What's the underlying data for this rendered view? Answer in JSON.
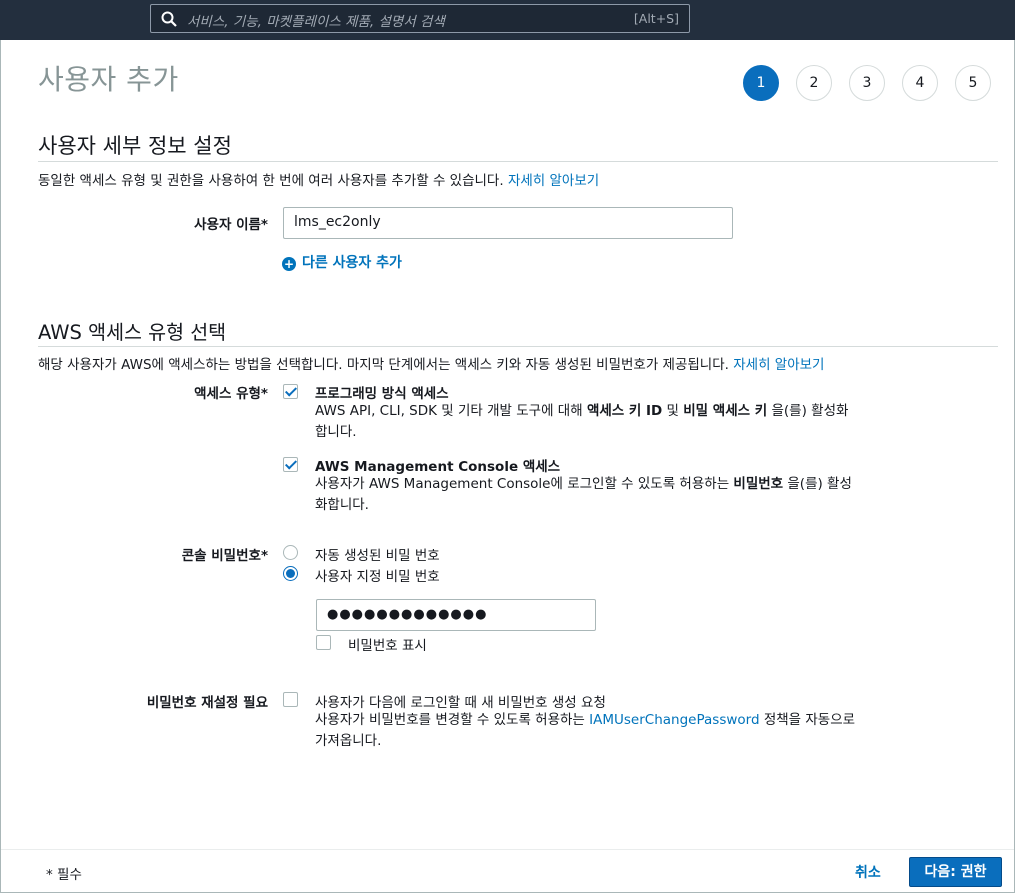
{
  "search": {
    "placeholder": "서비스, 기능, 마켓플레이스 제품, 설명서 검색",
    "shortcut": "[Alt+S]"
  },
  "page": {
    "title": "사용자 추가"
  },
  "steps": [
    "1",
    "2",
    "3",
    "4",
    "5"
  ],
  "active_step": 1,
  "details": {
    "title": "사용자 세부 정보 설정",
    "desc": "동일한 액세스 유형 및 권한을 사용하여 한 번에 여러 사용자를 추가할 수 있습니다. ",
    "learn_more": "자세히 알아보기",
    "username_label": "사용자 이름*",
    "username_value": "lms_ec2only",
    "add_user": "다른 사용자 추가"
  },
  "access": {
    "title": "AWS 액세스 유형 선택",
    "desc": "해당 사용자가 AWS에 액세스하는 방법을 선택합니다. 마지막 단계에서는 액세스 키와 자동 생성된 비밀번호가 제공됩니다. ",
    "learn_more": "자세히 알아보기",
    "type_label": "액세스 유형*",
    "programmatic": {
      "title": "프로그래밍 방식 액세스",
      "desc_1": "AWS API, CLI, SDK 및 기타 개발 도구에 대해 ",
      "desc_b1": "액세스 키 ID",
      "desc_2": " 및 ",
      "desc_b2": "비밀 액세스 키",
      "desc_3": " 을(를) 활성화합니다.",
      "checked": true
    },
    "console": {
      "title": "AWS Management Console 액세스",
      "desc_1": "사용자가 AWS Management Console에 로그인할 수 있도록 허용하는 ",
      "desc_b1": "비밀번호",
      "desc_2": " 을(를) 활성화합니다.",
      "checked": true
    },
    "password_label": "콘솔 비밀번호*",
    "auto_password": "자동 생성된 비밀 번호",
    "custom_password": "사용자 지정 비밀 번호",
    "password_value": "●●●●●●●●●●●●●",
    "show_password": "비밀번호 표시",
    "reset_label": "비밀번호 재설정 필요",
    "reset_title": "사용자가 다음에 로그인할 때 새 비밀번호 생성 요청",
    "reset_desc_1": "사용자가 비밀번호를 변경할 수 있도록 허용하는 ",
    "reset_policy": "IAMUserChangePassword",
    "reset_desc_2": " 정책을 자동으로 가져옵니다."
  },
  "footer": {
    "required": "* 필수",
    "cancel": "취소",
    "next": "다음: 권한"
  },
  "colors": {
    "topbar": "#232f3e",
    "accent": "#0a6ebd",
    "link": "#0073bb"
  }
}
